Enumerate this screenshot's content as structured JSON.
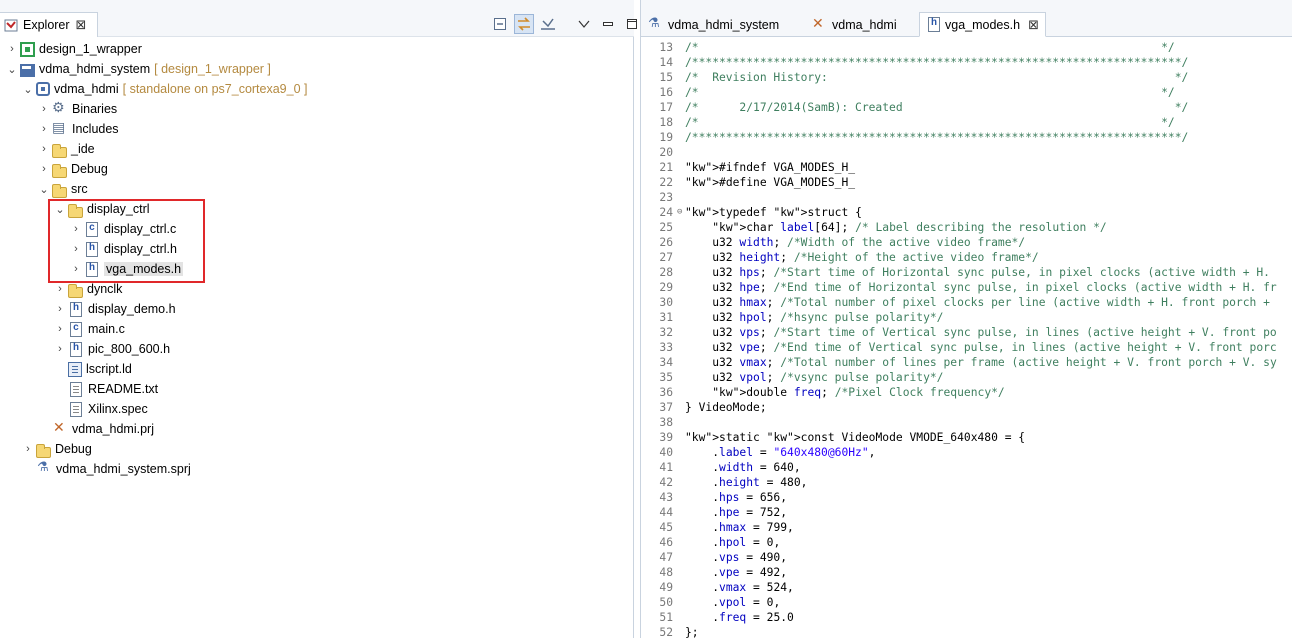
{
  "explorer": {
    "tab_label": "Explorer",
    "close_glyph": "⊠",
    "tree": [
      {
        "label": "design_1_wrapper",
        "decor": "",
        "icon": "project-green-icon",
        "depth": 0,
        "twisty": "›"
      },
      {
        "label": "vdma_hdmi_system",
        "decor": "[ design_1_wrapper ]",
        "icon": "system-project-icon",
        "depth": 0,
        "twisty": "⌄"
      },
      {
        "label": "vdma_hdmi",
        "decor": "[ standalone on ps7_cortexa9_0 ]",
        "icon": "app-project-icon",
        "depth": 1,
        "twisty": "⌄"
      },
      {
        "label": "Binaries",
        "decor": "",
        "icon": "binaries-icon",
        "depth": 2,
        "twisty": "›"
      },
      {
        "label": "Includes",
        "decor": "",
        "icon": "includes-icon",
        "depth": 2,
        "twisty": "›"
      },
      {
        "label": "_ide",
        "decor": "",
        "icon": "folder-icon",
        "depth": 2,
        "twisty": "›"
      },
      {
        "label": "Debug",
        "decor": "",
        "icon": "folder-icon",
        "depth": 2,
        "twisty": "›"
      },
      {
        "label": "src",
        "decor": "",
        "icon": "folder-icon",
        "depth": 2,
        "twisty": "⌄"
      },
      {
        "label": "display_ctrl",
        "decor": "",
        "icon": "folder-icon",
        "depth": 3,
        "twisty": "⌄"
      },
      {
        "label": "display_ctrl.c",
        "decor": "",
        "icon": "c-file-icon",
        "depth": 4,
        "twisty": "›"
      },
      {
        "label": "display_ctrl.h",
        "decor": "",
        "icon": "h-file-icon",
        "depth": 4,
        "twisty": "›"
      },
      {
        "label": "vga_modes.h",
        "decor": "",
        "icon": "h-file-icon",
        "depth": 4,
        "twisty": "›",
        "selected": true
      },
      {
        "label": "dynclk",
        "decor": "",
        "icon": "folder-icon",
        "depth": 3,
        "twisty": "›"
      },
      {
        "label": "display_demo.h",
        "decor": "",
        "icon": "h-file-icon",
        "depth": 3,
        "twisty": "›"
      },
      {
        "label": "main.c",
        "decor": "",
        "icon": "c-file-icon",
        "depth": 3,
        "twisty": "›"
      },
      {
        "label": "pic_800_600.h",
        "decor": "",
        "icon": "h-file-icon",
        "depth": 3,
        "twisty": "›"
      },
      {
        "label": "lscript.ld",
        "decor": "",
        "icon": "linker-script-icon",
        "depth": 3,
        "twisty": ""
      },
      {
        "label": "README.txt",
        "decor": "",
        "icon": "text-file-icon",
        "depth": 3,
        "twisty": ""
      },
      {
        "label": "Xilinx.spec",
        "decor": "",
        "icon": "text-file-icon",
        "depth": 3,
        "twisty": ""
      },
      {
        "label": "vdma_hdmi.prj",
        "decor": "",
        "icon": "prj-file-icon",
        "depth": 2,
        "twisty": ""
      },
      {
        "label": "Debug",
        "decor": "",
        "icon": "folder-icon",
        "depth": 1,
        "twisty": "›"
      },
      {
        "label": "vdma_hdmi_system.sprj",
        "decor": "",
        "icon": "sprj-file-icon",
        "depth": 1,
        "twisty": ""
      }
    ]
  },
  "editor": {
    "tabs": [
      {
        "label": "vdma_hdmi_system",
        "icon": "flask-icon",
        "active": false
      },
      {
        "label": "vdma_hdmi",
        "icon": "tools-icon",
        "active": false
      },
      {
        "label": "vga_modes.h",
        "icon": "h-file-icon",
        "active": true
      }
    ],
    "close_glyph": "⊠",
    "lines": [
      {
        "n": "13",
        "t": "/*                                                                    */",
        "c": "cm"
      },
      {
        "n": "14",
        "t": "/************************************************************************/",
        "c": "cm"
      },
      {
        "n": "15",
        "t": "/*  Revision History:                                                   */",
        "c": "cm"
      },
      {
        "n": "16",
        "t": "/*                                                                    */",
        "c": "cm"
      },
      {
        "n": "17",
        "t": "/*      2/17/2014(SamB): Created                                        */",
        "c": "cm"
      },
      {
        "n": "18",
        "t": "/*                                                                    */",
        "c": "cm"
      },
      {
        "n": "19",
        "t": "/************************************************************************/",
        "c": "cm"
      },
      {
        "n": "20",
        "t": "",
        "c": ""
      },
      {
        "n": "21",
        "t": "#ifndef VGA_MODES_H_",
        "c": "pp"
      },
      {
        "n": "22",
        "t": "#define VGA_MODES_H_",
        "c": "pp"
      },
      {
        "n": "23",
        "t": "",
        "c": ""
      },
      {
        "n": "24",
        "t": "typedef struct {",
        "c": "td",
        "fold": "⊖"
      },
      {
        "n": "25",
        "t": "    char label[64]; /* Label describing the resolution */",
        "c": "f1"
      },
      {
        "n": "26",
        "t": "    u32 width; /*Width of the active video frame*/",
        "c": "f2"
      },
      {
        "n": "27",
        "t": "    u32 height; /*Height of the active video frame*/",
        "c": "f2"
      },
      {
        "n": "28",
        "t": "    u32 hps; /*Start time of Horizontal sync pulse, in pixel clocks (active width + H.",
        "c": "f2"
      },
      {
        "n": "29",
        "t": "    u32 hpe; /*End time of Horizontal sync pulse, in pixel clocks (active width + H. fr",
        "c": "f2"
      },
      {
        "n": "30",
        "t": "    u32 hmax; /*Total number of pixel clocks per line (active width + H. front porch +",
        "c": "f2"
      },
      {
        "n": "31",
        "t": "    u32 hpol; /*hsync pulse polarity*/",
        "c": "f2"
      },
      {
        "n": "32",
        "t": "    u32 vps; /*Start time of Vertical sync pulse, in lines (active height + V. front po",
        "c": "f2"
      },
      {
        "n": "33",
        "t": "    u32 vpe; /*End time of Vertical sync pulse, in lines (active height + V. front porc",
        "c": "f2"
      },
      {
        "n": "34",
        "t": "    u32 vmax; /*Total number of lines per frame (active height + V. front porch + V. sy",
        "c": "f2"
      },
      {
        "n": "35",
        "t": "    u32 vpol; /*vsync pulse polarity*/",
        "c": "f2"
      },
      {
        "n": "36",
        "t": "    double freq; /*Pixel Clock frequency*/",
        "c": "f3"
      },
      {
        "n": "37",
        "t": "} VideoMode;",
        "c": ""
      },
      {
        "n": "38",
        "t": "",
        "c": ""
      },
      {
        "n": "39",
        "t": "static const VideoMode VMODE_640x480 = {",
        "c": "sc"
      },
      {
        "n": "40",
        "t": "    .label = \"640x480@60Hz\",",
        "c": "lb"
      },
      {
        "n": "41",
        "t": "    .width = 640,",
        "c": "as"
      },
      {
        "n": "42",
        "t": "    .height = 480,",
        "c": "as"
      },
      {
        "n": "43",
        "t": "    .hps = 656,",
        "c": "as"
      },
      {
        "n": "44",
        "t": "    .hpe = 752,",
        "c": "as"
      },
      {
        "n": "45",
        "t": "    .hmax = 799,",
        "c": "as"
      },
      {
        "n": "46",
        "t": "    .hpol = 0,",
        "c": "as"
      },
      {
        "n": "47",
        "t": "    .vps = 490,",
        "c": "as"
      },
      {
        "n": "48",
        "t": "    .vpe = 492,",
        "c": "as"
      },
      {
        "n": "49",
        "t": "    .vmax = 524,",
        "c": "as"
      },
      {
        "n": "50",
        "t": "    .vpol = 0,",
        "c": "as"
      },
      {
        "n": "51",
        "t": "    .freq = 25.0",
        "c": "as"
      },
      {
        "n": "52",
        "t": "};",
        "c": ""
      }
    ]
  },
  "colors": {
    "highlight_box": "#e0282a",
    "comment": "#3f7f5f",
    "keyword": "#7f0055",
    "string": "#2a00ff",
    "field": "#0000c0"
  }
}
